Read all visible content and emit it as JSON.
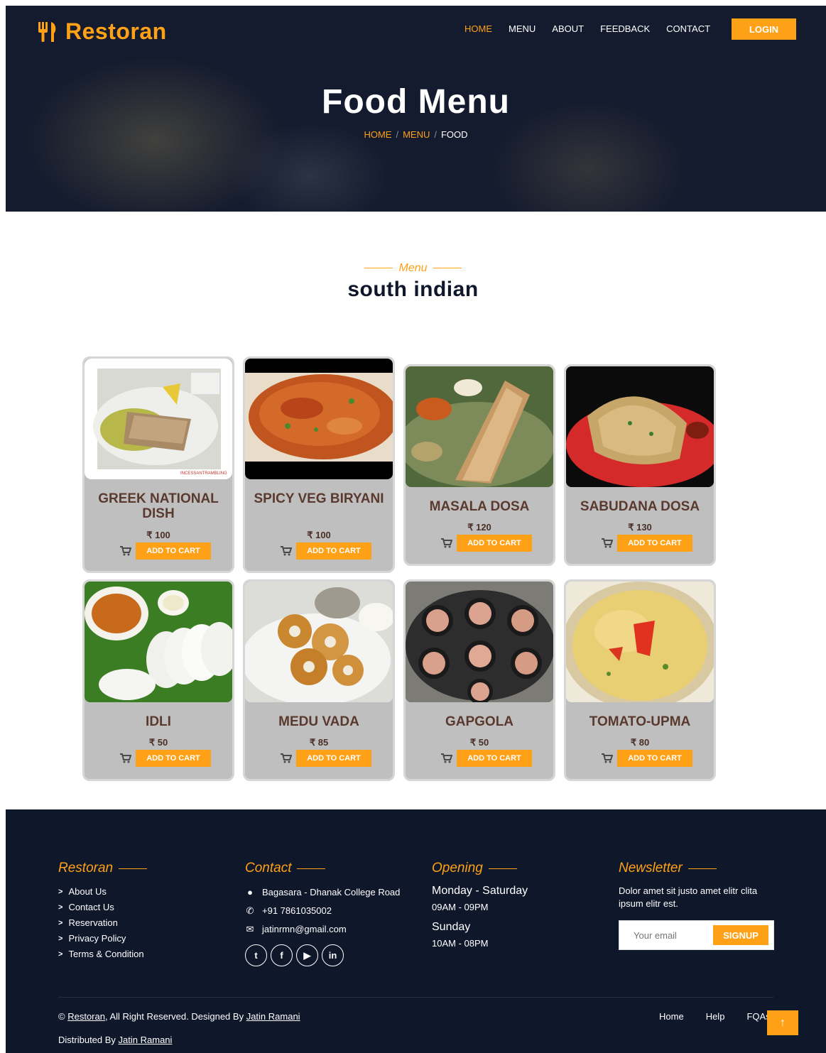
{
  "brand": {
    "name": "Restoran",
    "icon": "utensils-icon"
  },
  "nav": {
    "items": [
      {
        "label": "HOME",
        "active": true
      },
      {
        "label": "MENU",
        "active": false
      },
      {
        "label": "ABOUT",
        "active": false
      },
      {
        "label": "FEEDBACK",
        "active": false
      },
      {
        "label": "CONTACT",
        "active": false
      }
    ],
    "login_label": "LOGIN"
  },
  "hero": {
    "title": "Food Menu",
    "breadcrumb": {
      "home": "HOME",
      "menu": "MENU",
      "current": "FOOD",
      "sep": "/"
    }
  },
  "section": {
    "subtitle": "Menu",
    "title": "south indian"
  },
  "currency": "₹",
  "add_label": "ADD TO CART",
  "items": [
    {
      "name": "GREEK NATIONAL DISH",
      "price": "₹ 100"
    },
    {
      "name": "SPICY VEG BIRYANI",
      "price": "₹ 100"
    },
    {
      "name": "MASALA DOSA",
      "price": "₹ 120"
    },
    {
      "name": "SABUDANA DOSA",
      "price": "₹ 130"
    },
    {
      "name": "IDLI",
      "price": "₹ 50"
    },
    {
      "name": "MEDU VADA",
      "price": "₹ 85"
    },
    {
      "name": "GAPGOLA",
      "price": "₹ 50"
    },
    {
      "name": "TOMATO-UPMA",
      "price": "₹ 80"
    }
  ],
  "footer": {
    "restoran": {
      "heading": "Restoran",
      "links": [
        "About Us",
        "Contact Us",
        "Reservation",
        "Privacy Policy",
        "Terms & Condition"
      ]
    },
    "contact": {
      "heading": "Contact",
      "address": "Bagasara - Dhanak College Road",
      "phone": "+91 7861035002",
      "email": "jatinrmn@gmail.com",
      "socials": [
        "twitter-icon",
        "facebook-icon",
        "youtube-icon",
        "linkedin-icon"
      ]
    },
    "opening": {
      "heading": "Opening",
      "day1": "Monday - Saturday",
      "time1": "09AM - 09PM",
      "day2": "Sunday",
      "time2": "10AM - 08PM"
    },
    "newsletter": {
      "heading": "Newsletter",
      "text": "Dolor amet sit justo amet elitr clita ipsum elitr est.",
      "placeholder": "Your email",
      "button": "SIGNUP"
    },
    "copyright_prefix": "©",
    "copyright_brand": "Restoran",
    "copyright_text": ", All Right Reserved. Designed By",
    "designer": "Jatin Ramani",
    "distributed_text": "Distributed By",
    "distributor": "Jatin Ramani",
    "bottom_links": [
      "Home",
      "Help",
      "FQAs"
    ],
    "to_top": "↑"
  },
  "colors": {
    "accent": "#fea116",
    "dark": "#0f172b",
    "card": "#bfbfbf"
  }
}
